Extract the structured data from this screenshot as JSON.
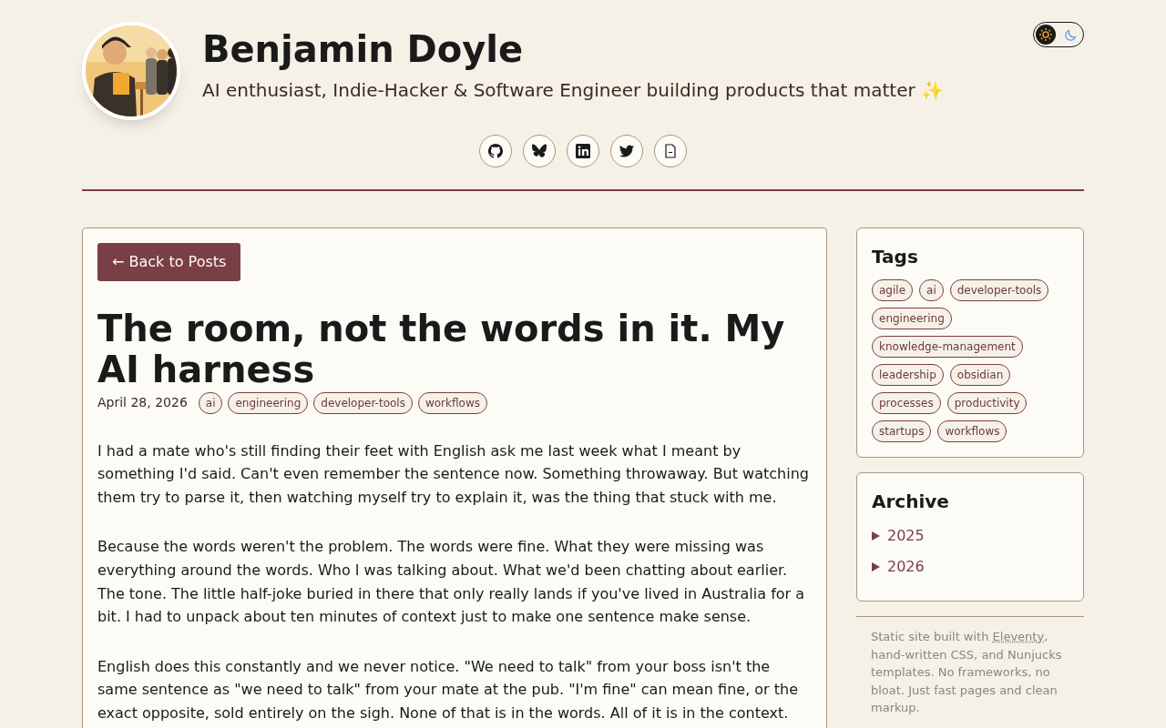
{
  "theme_toggle": {
    "options": [
      {
        "kind": "sun",
        "selected": true
      },
      {
        "kind": "moon",
        "selected": false
      }
    ]
  },
  "header": {
    "name": "Benjamin Doyle",
    "tagline": "AI enthusiast, Indie-Hacker & Software Engineer building products that matter ✨",
    "social_links": [
      {
        "kind": "github"
      },
      {
        "kind": "bluesky"
      },
      {
        "kind": "linkedin"
      },
      {
        "kind": "twitter"
      },
      {
        "kind": "cv"
      }
    ]
  },
  "post": {
    "back_button": "← Back to Posts",
    "title": "The room, not the words in it. My AI harness",
    "date": "April 28, 2026",
    "tags": [
      "ai",
      "engineering",
      "developer-tools",
      "workflows"
    ],
    "paragraphs": [
      "I had a mate who's still finding their feet with English ask me last week what I meant by something I'd said. Can't even remember the sentence now. Something throwaway. But watching them try to parse it, then watching myself try to explain it, was the thing that stuck with me.",
      "Because the words weren't the problem. The words were fine. What they were missing was everything around the words. Who I was talking about. What we'd been chatting about earlier. The tone. The little half-joke buried in there that only really lands if you've lived in Australia for a bit. I had to unpack about ten minutes of context just to make one sentence make sense.",
      "English does this constantly and we never notice. \"We need to talk\" from your boss isn't the same sentence as \"we need to talk\" from your mate at the pub. \"I'm fine\" can mean fine, or the exact opposite, sold entirely on the sigh. None of that is in the words. All of it is in the context."
    ]
  },
  "sidebar": {
    "tags": {
      "title": "Tags",
      "items": [
        "agile",
        "ai",
        "developer-tools",
        "engineering",
        "knowledge-management",
        "leadership",
        "obsidian",
        "processes",
        "productivity",
        "startups",
        "workflows"
      ]
    },
    "archive": {
      "title": "Archive",
      "years": [
        {
          "label": "2025",
          "expanded": false
        },
        {
          "label": "2026",
          "expanded": false
        }
      ]
    },
    "footer": {
      "before": "Static site built with ",
      "link": "Eleventy",
      "after": ", hand-written CSS, and Nunjucks templates. No frameworks, no bloat. Just fast pages and clean markup."
    }
  }
}
